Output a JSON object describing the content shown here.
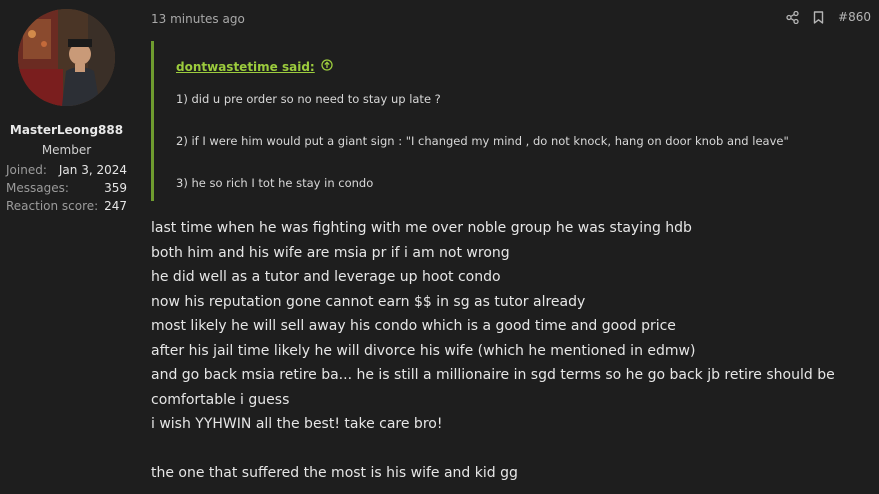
{
  "user": {
    "name": "MasterLeong888",
    "title": "Member",
    "stats": [
      {
        "label": "Joined:",
        "value": "Jan 3, 2024"
      },
      {
        "label": "Messages:",
        "value": "359"
      },
      {
        "label": "Reaction score:",
        "value": "247"
      }
    ]
  },
  "post": {
    "time": "13 minutes ago",
    "number": "#860",
    "share_icon": "share-icon",
    "bookmark_icon": "bookmark-icon",
    "quote": {
      "author": "dontwastetime said:",
      "lines": [
        "1) did u pre order so no need to stay up late ?",
        "2) if I were him would put a giant sign : \"I changed my mind , do not knock, hang on door knob and leave\"",
        "3) he so rich I tot he stay in condo"
      ]
    },
    "body_lines": [
      "last time when he was fighting with me over noble group he was staying hdb",
      "both him and his wife are msia pr if i am not wrong",
      "he did well as a tutor and leverage up hoot condo",
      "now his reputation gone cannot earn $$ in sg as tutor already",
      "most likely he will sell away his condo which is a good time and good price",
      "after his jail time likely he will divorce his wife (which he mentioned in edmw)",
      "and go back msia retire ba... he is still a millionaire in sgd terms so he go back jb retire should be comfortable i guess",
      "i wish YYHWIN all the best! take care bro!",
      "the one that suffered the most is his wife and kid gg"
    ]
  },
  "colors": {
    "background": "#1e1e1e",
    "quote_accent": "#6f9c2f",
    "quote_author": "#9ccc3d"
  }
}
